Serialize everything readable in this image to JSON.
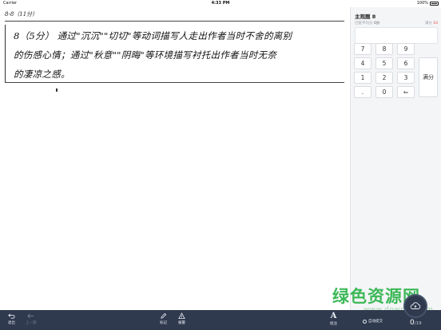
{
  "status_bar": {
    "carrier": "Carrier",
    "time": "4:33 PM",
    "battery": "100%"
  },
  "answer_sheet": {
    "question_label": "8-8（11分）",
    "handwriting_lines": [
      "8（5分） 通过\"沉沉\"\"切切\"等动词描写人走出作者当时不舍的离别",
      "的伤感心情；通过\"秋意\"\"阴晦\"等环境描写衬托出作者当时无奈",
      "的凄凉之感。"
    ]
  },
  "side_panel": {
    "question_title": "主观题 8",
    "avg_label": "已批平均分",
    "avg_value": "0分",
    "full_label": "满分",
    "full_value": "10",
    "keypad": {
      "keys": [
        "7",
        "8",
        "9",
        "4",
        "5",
        "6",
        "1",
        "2",
        "3",
        ".",
        "0",
        "⇐"
      ],
      "full_score_label": "满分"
    }
  },
  "toolbar": {
    "exit_label": "退出",
    "prev_label": "上一题",
    "mark_label": "标记",
    "report_label": "报警",
    "annotate_icon_text": "A",
    "annotate_label": "批注",
    "auto_submit_label": "自动提交",
    "progress_done": "0",
    "progress_total": "/19"
  },
  "watermark": {
    "text": "绿色资源网",
    "url": "www.downcc.com"
  },
  "colors": {
    "toolbar_bg": "#2f3a4f",
    "accent_red": "#e0453a",
    "watermark_green": "#2db34a"
  }
}
